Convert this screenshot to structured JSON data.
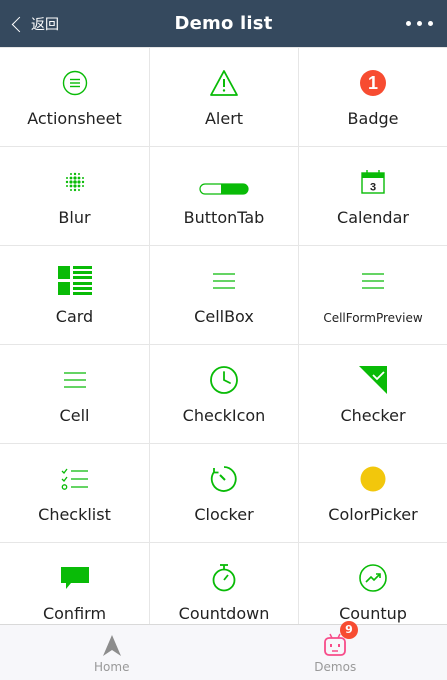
{
  "header": {
    "back_label": "返回",
    "title": "Demo list"
  },
  "accent_color": "#09bb07",
  "items": [
    {
      "label": "Actionsheet",
      "icon": "actionsheet-icon"
    },
    {
      "label": "Alert",
      "icon": "warning-triangle-icon"
    },
    {
      "label": "Badge",
      "icon": "badge-icon",
      "badge_value": "1"
    },
    {
      "label": "Blur",
      "icon": "blur-dots-icon"
    },
    {
      "label": "ButtonTab",
      "icon": "button-tab-icon"
    },
    {
      "label": "Calendar",
      "icon": "calendar-icon",
      "calendar_day": "3"
    },
    {
      "label": "Card",
      "icon": "card-grid-icon"
    },
    {
      "label": "CellBox",
      "icon": "list-lines-icon"
    },
    {
      "label": "CellFormPreview",
      "icon": "list-lines-icon"
    },
    {
      "label": "Cell",
      "icon": "list-lines-icon"
    },
    {
      "label": "CheckIcon",
      "icon": "clock-icon"
    },
    {
      "label": "Checker",
      "icon": "checker-corner-icon"
    },
    {
      "label": "Checklist",
      "icon": "checklist-icon"
    },
    {
      "label": "Clocker",
      "icon": "timer-clock-icon"
    },
    {
      "label": "ColorPicker",
      "icon": "color-dot-icon"
    },
    {
      "label": "Confirm",
      "icon": "chat-bubble-icon"
    },
    {
      "label": "Countdown",
      "icon": "stopwatch-icon"
    },
    {
      "label": "Countup",
      "icon": "trend-up-icon"
    }
  ],
  "tabbar": {
    "home_label": "Home",
    "demos_label": "Demos",
    "demos_badge": "9"
  }
}
